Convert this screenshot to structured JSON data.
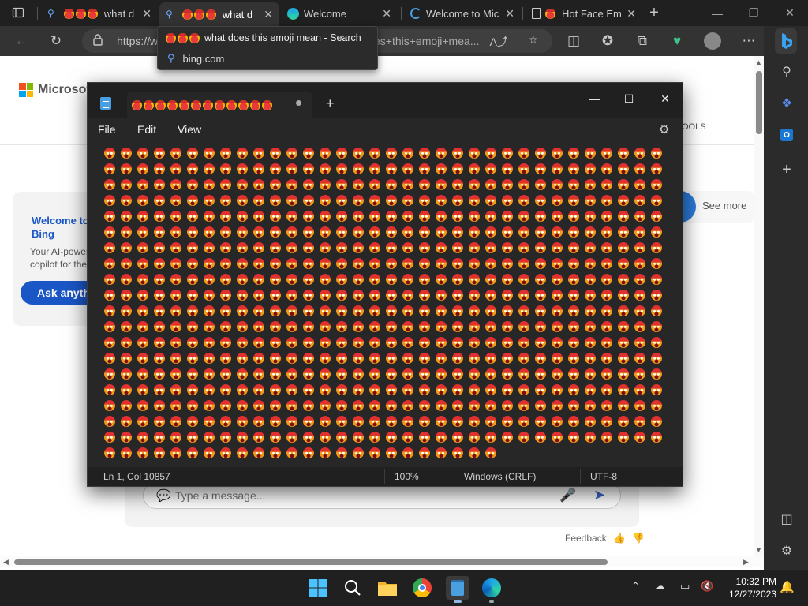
{
  "browser": {
    "tabs": [
      {
        "title": "what d",
        "icon": "search-icon",
        "active": false
      },
      {
        "title": "what d",
        "icon": "search-icon",
        "active": true
      },
      {
        "title": "Welcome",
        "icon": "edge-icon",
        "active": false
      },
      {
        "title": "Welcome to Mic",
        "icon": "loading-icon",
        "active": false
      },
      {
        "title": "Hot Face Em",
        "icon": "page-icon",
        "active": false
      }
    ],
    "address": {
      "url_left": "https://w",
      "url_right": "es+this+emoji+mea..."
    },
    "tooltip": {
      "title": "what does this emoji mean - Search",
      "domain": "bing.com"
    }
  },
  "page": {
    "brand": "Microsoft",
    "tools_label": "OOLS",
    "welcome_title": "Welcome to new Bing",
    "welcome_sub": "Your AI-powered copilot for the",
    "ask_button": "Ask anythi",
    "see_more": "See more",
    "message_placeholder": "Type a message...",
    "feedback": "Feedback"
  },
  "notepad": {
    "menu": {
      "file": "File",
      "edit": "Edit",
      "view": "View"
    },
    "emoji_name": "hot-face",
    "emoji_count_visible": 670,
    "status": {
      "position": "Ln 1, Col 10857",
      "zoom": "100%",
      "line_endings": "Windows (CRLF)",
      "encoding": "UTF-8"
    }
  },
  "taskbar": {
    "time": "10:32 PM",
    "date": "12/27/2023",
    "apps": [
      "start-icon",
      "search-icon",
      "file-explorer-icon",
      "chrome-icon",
      "notepad-icon",
      "edge-icon"
    ]
  },
  "colors": {
    "accent": "#1a56c6",
    "notepad_bg": "#272727",
    "taskbar_bg": "#202020"
  }
}
